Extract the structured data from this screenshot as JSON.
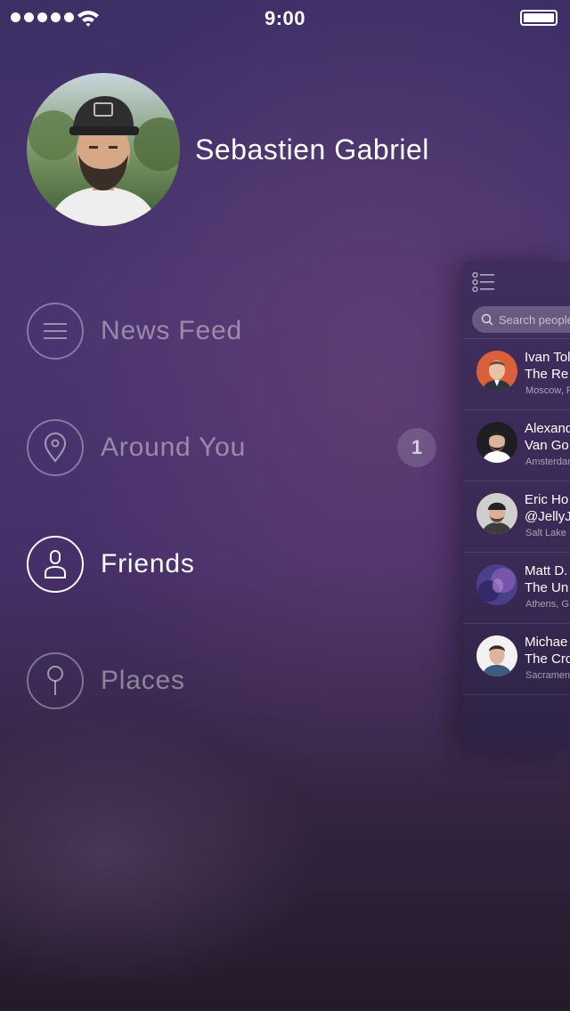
{
  "status_bar": {
    "signal_bars": 5,
    "time": "9:00",
    "battery_level": 1.0
  },
  "profile": {
    "name": "Sebastien Gabriel"
  },
  "menu": {
    "items": [
      {
        "label": "News Feed",
        "icon": "hamburger-icon",
        "active": false
      },
      {
        "label": "Around You",
        "icon": "location-pin-icon",
        "active": false,
        "badge": "1"
      },
      {
        "label": "Friends",
        "icon": "person-icon",
        "active": true
      },
      {
        "label": "Places",
        "icon": "map-pin-icon",
        "active": false
      }
    ]
  },
  "panel": {
    "search_placeholder": "Search people",
    "contacts": [
      {
        "line1": "Ivan Tol",
        "line2": "The Re",
        "location": "Moscow, R"
      },
      {
        "line1": "Alexand",
        "line2": "Van Go",
        "location": "Amsterdam"
      },
      {
        "line1": "Eric Ho",
        "line2": "@JellyJ",
        "location": "Salt Lake"
      },
      {
        "line1": "Matt D.",
        "line2": "The Un",
        "location": "Athens, G"
      },
      {
        "line1": "Michae",
        "line2": "The Cro",
        "location": "Sacramen"
      }
    ]
  },
  "colors": {
    "background_top": "#3d2f66",
    "background_bottom": "#241a2a",
    "panel": "#3f2d5e",
    "text_primary": "#ffffff"
  }
}
